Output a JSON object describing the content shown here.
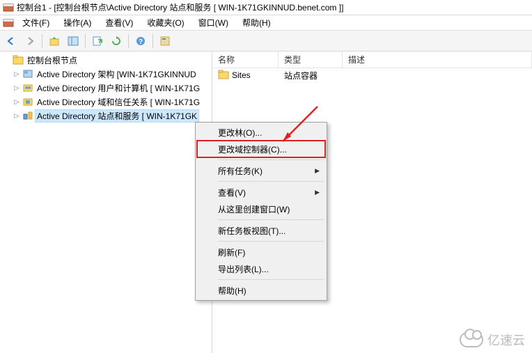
{
  "title": "控制台1 - [控制台根节点\\Active Directory 站点和服务 [ WIN-1K71GKINNUD.benet.com ]]",
  "menubar": {
    "items": [
      "文件(F)",
      "操作(A)",
      "查看(V)",
      "收藏夹(O)",
      "窗口(W)",
      "帮助(H)"
    ]
  },
  "tree": {
    "root": "控制台根节点",
    "children": [
      "Active Directory 架构 [WIN-1K71GKINNUD",
      "Active Directory 用户和计算机 [ WIN-1K71G",
      "Active Directory 域和信任关系 [ WIN-1K71G",
      "Active Directory 站点和服务 [ WIN-1K71GK"
    ]
  },
  "list": {
    "columns": [
      "名称",
      "类型",
      "描述"
    ],
    "rows": [
      {
        "name": "Sites",
        "type": "站点容器",
        "desc": ""
      }
    ]
  },
  "context_menu": {
    "items": [
      {
        "label": "更改林(O)...",
        "sub": false
      },
      {
        "label": "更改域控制器(C)...",
        "sub": false,
        "highlight": true
      },
      {
        "sep": true
      },
      {
        "label": "所有任务(K)",
        "sub": true
      },
      {
        "sep": true
      },
      {
        "label": "查看(V)",
        "sub": true
      },
      {
        "label": "从这里创建窗口(W)",
        "sub": false
      },
      {
        "sep": true
      },
      {
        "label": "新任务板视图(T)...",
        "sub": false
      },
      {
        "sep": true
      },
      {
        "label": "刷新(F)",
        "sub": false
      },
      {
        "label": "导出列表(L)...",
        "sub": false
      },
      {
        "sep": true
      },
      {
        "label": "帮助(H)",
        "sub": false
      }
    ]
  },
  "watermark": "亿速云"
}
